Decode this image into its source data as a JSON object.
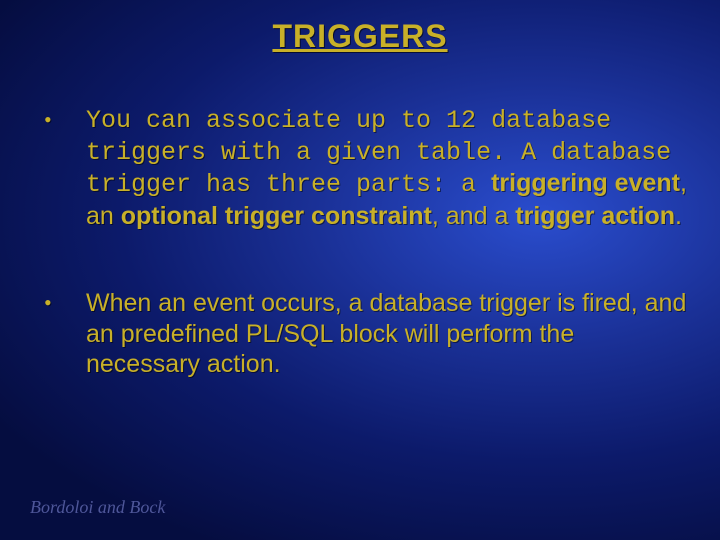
{
  "title": "TRIGGERS",
  "bullet1": {
    "seg1": "You can associate up to 12 database triggers with a given table. A database trigger has three parts: a ",
    "seg2": "triggering event",
    "seg3": ", an ",
    "seg4": "optional trigger constraint",
    "seg5": ", and a ",
    "seg6": "trigger action",
    "seg7": "."
  },
  "bullet2": "When an event occurs, a database trigger is fired, and an predefined PL/SQL block will perform the necessary action.",
  "footer": "Bordoloi and Bock"
}
